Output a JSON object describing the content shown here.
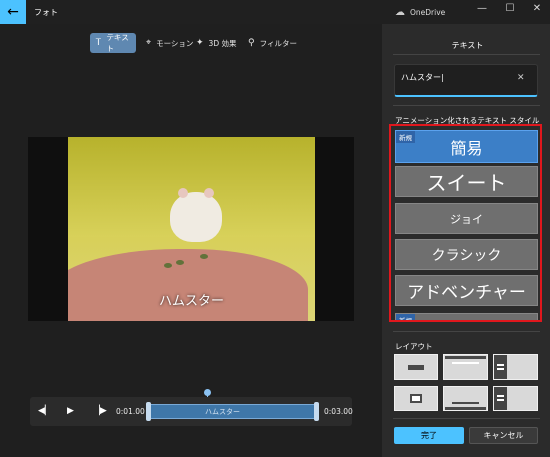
{
  "app": {
    "title": "フォト",
    "onedrive_label": "OneDrive"
  },
  "window_controls": {
    "minimize": "—",
    "maximize": "☐",
    "close": "✕"
  },
  "toolbar": {
    "tabs": [
      {
        "label": "テキスト",
        "icon": "text-icon",
        "active": true
      },
      {
        "label": "モーション",
        "icon": "motion-icon",
        "active": false
      },
      {
        "label": "3D 効果",
        "icon": "3d-effects-icon",
        "active": false
      },
      {
        "label": "フィルター",
        "icon": "filter-icon",
        "active": false
      }
    ]
  },
  "preview": {
    "caption": "ハムスター"
  },
  "timeline": {
    "start_time": "0:01.00",
    "end_time": "0:03.00",
    "clip_label": "ハムスター"
  },
  "panel": {
    "title": "テキスト",
    "text_value": "ハムスター",
    "styles_label": "アニメーション化されるテキスト スタイル",
    "styles": [
      {
        "label": "簡易",
        "badge": "新規",
        "selected": true
      },
      {
        "label": "スイート",
        "badge": "",
        "selected": false
      },
      {
        "label": "ジョイ",
        "badge": "",
        "selected": false
      },
      {
        "label": "クラシック",
        "badge": "",
        "selected": false
      },
      {
        "label": "アドベンチャー",
        "badge": "",
        "selected": false
      },
      {
        "label": "",
        "badge": "新規",
        "selected": false
      }
    ],
    "layout_label": "レイアウト",
    "done_label": "完了",
    "cancel_label": "キャンセル"
  },
  "colors": {
    "accent": "#4cc2ff",
    "selected_style": "#3c7fc7",
    "highlight_border": "#e0171d"
  }
}
